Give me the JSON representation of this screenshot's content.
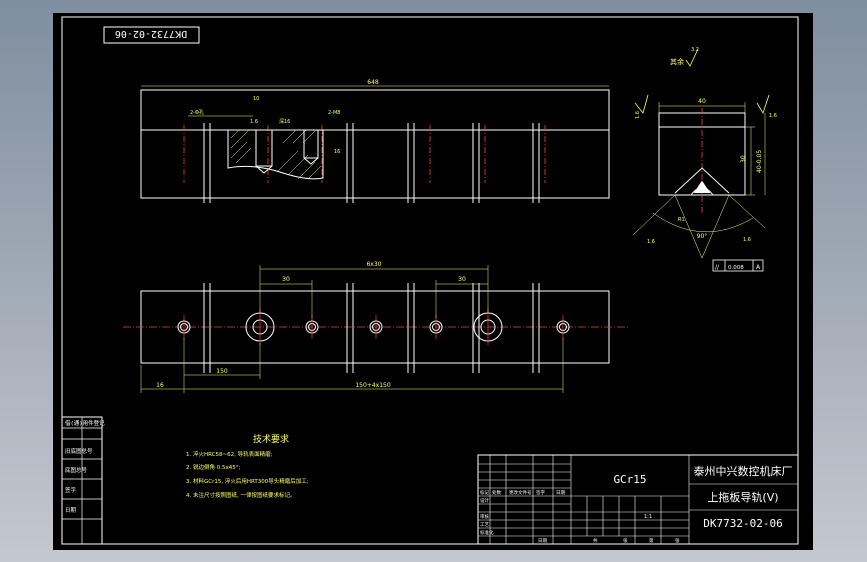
{
  "drawing": {
    "rotated_code": "DK7732-02-06",
    "roughness_other_label": "其余",
    "roughness_other_value": "3.2",
    "dims_top": {
      "overall_length": "648",
      "roughness_1": "1.6",
      "note_holes": "2-Φ孔",
      "note_thread": "2-M8",
      "note_thread_depth": "深16",
      "dim_small_a": "10",
      "dim_small_b": "16"
    },
    "dims_bottom": {
      "spacing_1": "30",
      "spacing_2": "30",
      "span_center": "6x30",
      "left_offset": "16",
      "pitch": "150",
      "total_chain": "150+4x150"
    },
    "section": {
      "width": "40",
      "height": "30",
      "full_height": "40-0.05",
      "ra_top": "1.6",
      "ra_right": "1.6",
      "angle": "90°",
      "chamfer": "R1",
      "ra_bottom": "1.6",
      "tol_symbol": "//",
      "tol_value": "0.008",
      "tol_datum": "A",
      "ra_left": "1.6"
    },
    "tech_req": {
      "title": "技术要求",
      "items": [
        "1. 淬火HRC58~62, 导轨表面精磨;",
        "2. 锐边倒角 0.5x45°;",
        "3. 材料GCr15, 淬火后用HRT300导头精磨后加工;",
        "4. 未注尺寸按照图纸, 一律按图纸要求标记。"
      ]
    },
    "title_block": {
      "material": "GCr15",
      "company": "泰州中兴数控机床厂",
      "part_name": "上拖板导轨(V)",
      "drawing_no": "DK7732-02-06",
      "scale": "1:1",
      "cols_header": [
        "标记",
        "处数",
        "更改文件号",
        "签字",
        "日期"
      ],
      "row_labels": [
        "设计",
        "审核",
        "工艺",
        "标准化"
      ],
      "bottom_labels": [
        "共",
        "张",
        "第",
        "张"
      ],
      "date_label": "日期"
    },
    "left_block": {
      "rows": [
        "借(通)用件登记",
        "旧底图总号",
        "底图总号",
        "签字",
        "日期"
      ]
    }
  }
}
